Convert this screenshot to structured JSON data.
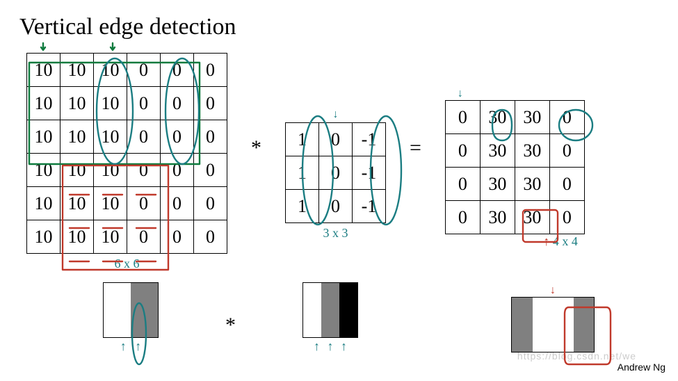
{
  "title": "Vertical edge detection",
  "credit": "Andrew Ng",
  "watermark": "https://blog.csdn.net/we",
  "operators": {
    "conv": "*",
    "eq": "="
  },
  "annotations": {
    "input_dim": "6 x 6",
    "filter_dim": "3 x 3",
    "output_dim": "4 x 4"
  },
  "arrows": {
    "down": "↓",
    "up": "↑"
  },
  "chart_data": {
    "type": "table",
    "input_matrix": {
      "rows": 6,
      "cols": 6,
      "values": [
        [
          10,
          10,
          10,
          0,
          0,
          0
        ],
        [
          10,
          10,
          10,
          0,
          0,
          0
        ],
        [
          10,
          10,
          10,
          0,
          0,
          0
        ],
        [
          10,
          10,
          10,
          0,
          0,
          0
        ],
        [
          10,
          10,
          10,
          0,
          0,
          0
        ],
        [
          10,
          10,
          10,
          0,
          0,
          0
        ]
      ]
    },
    "filter": {
      "rows": 3,
      "cols": 3,
      "values": [
        [
          1,
          0,
          -1
        ],
        [
          1,
          0,
          -1
        ],
        [
          1,
          0,
          -1
        ]
      ]
    },
    "output_matrix": {
      "rows": 4,
      "cols": 4,
      "values": [
        [
          0,
          30,
          30,
          0
        ],
        [
          0,
          30,
          30,
          0
        ],
        [
          0,
          30,
          30,
          0
        ],
        [
          0,
          30,
          30,
          0
        ]
      ]
    },
    "gradient_input": [
      "white",
      "gray"
    ],
    "gradient_filter": [
      "white",
      "gray",
      "black"
    ],
    "gradient_output": [
      "gray",
      "white",
      "gray"
    ]
  }
}
